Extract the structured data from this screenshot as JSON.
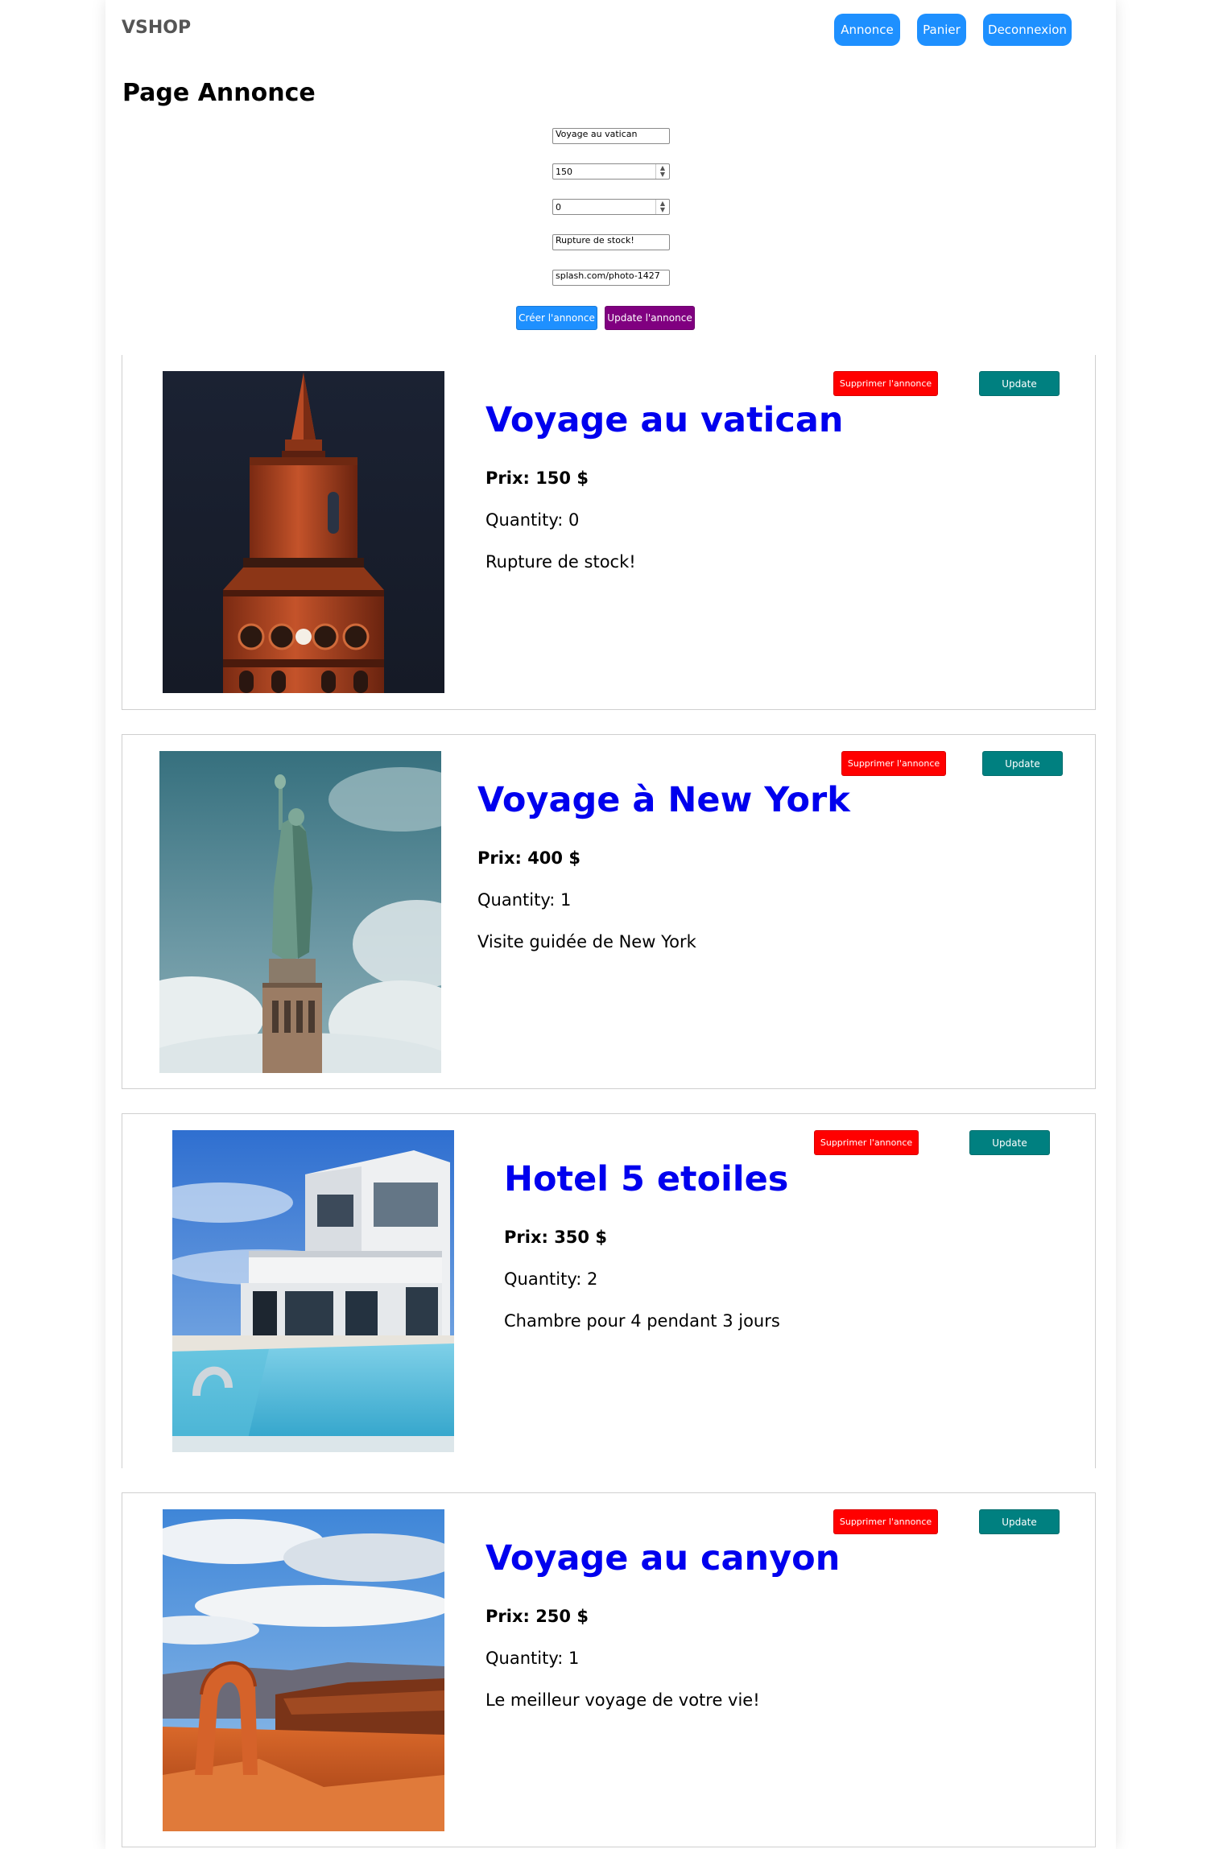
{
  "header": {
    "brand": "VSHOP",
    "nav": {
      "annonce": "Annonce",
      "panier": "Panier",
      "deconnexion": "Deconnexion"
    }
  },
  "page_title": "Page Annonce",
  "form": {
    "title_value": "Voyage au vatican",
    "price_value": "150",
    "quantity_value": "0",
    "description_value": "Rupture de stock!",
    "image_value": "splash.com/photo-1427",
    "create_label": "Créer l'annonce",
    "update_label": "Update l'annonce"
  },
  "colors": {
    "nav_button": "#1e90ff",
    "create_button": "#1e90ff",
    "update_form_button": "#800080",
    "delete_button": "#ff0000",
    "update_button": "#008080",
    "title_text": "#0000ee"
  },
  "annonces": [
    {
      "title": "Voyage au vatican",
      "price": "Prix: 150 $",
      "quantity": "Quantity: 0",
      "description": "Rupture de stock!",
      "image": "brick-clock-tower-at-night",
      "delete_label": "Supprimer l'annonce",
      "update_label": "Update"
    },
    {
      "title": "Voyage à New York",
      "price": "Prix: 400 $",
      "quantity": "Quantity: 1",
      "description": "Visite guidée de New York",
      "image": "statue-of-liberty",
      "delete_label": "Supprimer l'annonce",
      "update_label": "Update"
    },
    {
      "title": "Hotel 5 etoiles",
      "price": "Prix: 350 $",
      "quantity": "Quantity: 2",
      "description": "Chambre pour 4 pendant 3 jours",
      "image": "modern-villa-with-pool",
      "delete_label": "Supprimer l'annonce",
      "update_label": "Update"
    },
    {
      "title": "Voyage au canyon",
      "price": "Prix: 250 $",
      "quantity": "Quantity: 1",
      "description": "Le meilleur voyage de votre vie!",
      "image": "desert-rock-arch-canyon",
      "delete_label": "Supprimer l'annonce",
      "update_label": "Update"
    }
  ]
}
